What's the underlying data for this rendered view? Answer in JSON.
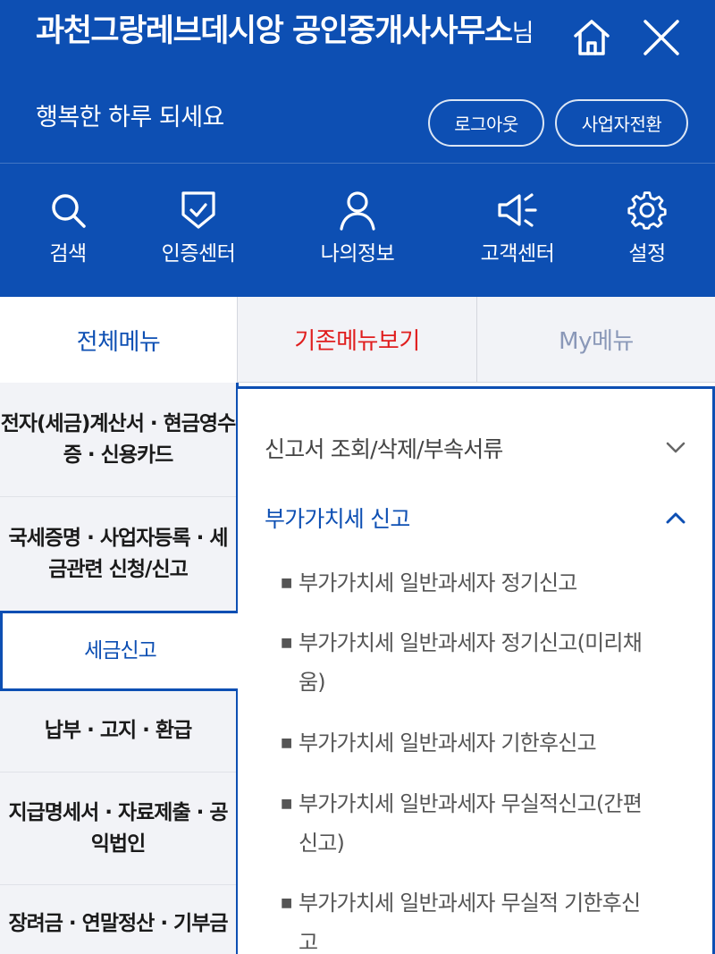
{
  "header": {
    "user_name": "과천그랑레브데시앙 공인중개사사무소",
    "user_suffix": "님",
    "greeting": "행복한 하루 되세요",
    "logout_label": "로그아웃",
    "switch_label": "사업자전환",
    "home_icon": "home-icon",
    "close_icon": "close-icon"
  },
  "quicknav": [
    {
      "label": "검색",
      "icon": "search-icon"
    },
    {
      "label": "인증센터",
      "icon": "shield-check-icon"
    },
    {
      "label": "나의정보",
      "icon": "user-icon"
    },
    {
      "label": "고객센터",
      "icon": "megaphone-icon"
    },
    {
      "label": "설정",
      "icon": "gear-icon"
    }
  ],
  "tabs": [
    {
      "label": "전체메뉴",
      "active": true
    },
    {
      "label": "기존메뉴보기",
      "color": "#e01e1e"
    },
    {
      "label": "My메뉴"
    }
  ],
  "left_menu": [
    {
      "label": "전자(세금)계산서 · 현금영수증 · 신용카드"
    },
    {
      "label": "국세증명 · 사업자등록 · 세금관련 신청/신고"
    },
    {
      "label": "세금신고",
      "active": true
    },
    {
      "label": "납부 · 고지 · 환급"
    },
    {
      "label": "지급명세서 · 자료제출 · 공익법인"
    },
    {
      "label": "장려금 · 연말정산 · 기부금"
    }
  ],
  "right_panel": {
    "sections": [
      {
        "label": "신고서 조회/삭제/부속서류",
        "expanded": false,
        "icon": "chevron-down-icon"
      },
      {
        "label": "부가가치세 신고",
        "expanded": true,
        "icon": "chevron-up-icon"
      }
    ],
    "sub_items": [
      "부가가치세 일반과세자 정기신고",
      "부가가치세 일반과세자 정기신고(미리채움)",
      "부가가치세 일반과세자 기한후신고",
      "부가가치세 일반과세자 무실적신고(간편신고)",
      "부가가치세 일반과세자 무실적 기한후신고"
    ]
  },
  "colors": {
    "brand_blue": "#0d4fb3",
    "tab_red": "#e01e1e",
    "inactive_tab": "#8a98b8"
  }
}
